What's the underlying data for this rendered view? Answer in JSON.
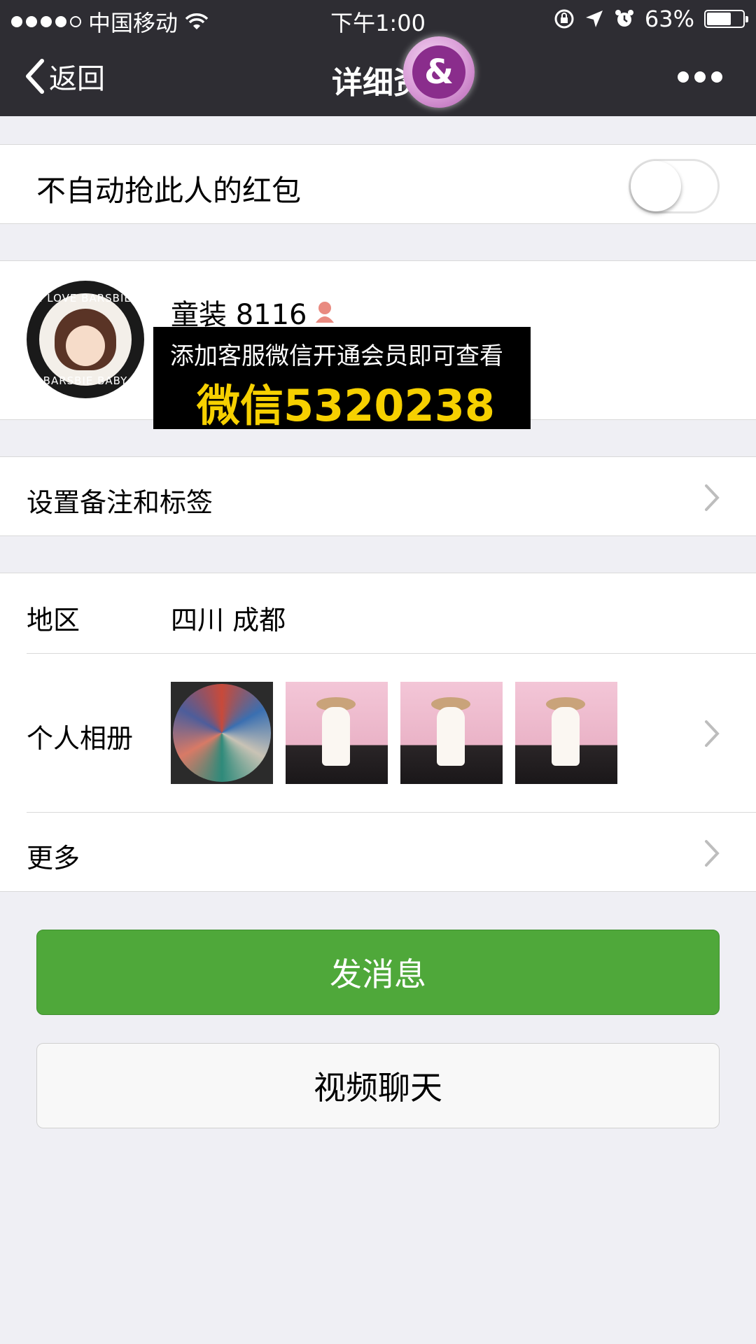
{
  "status_bar": {
    "carrier": "中国移动",
    "time": "下午1:00",
    "battery": "63%",
    "battery_level": 0.63
  },
  "nav": {
    "back_label": "返回",
    "title": "详细资",
    "watermark_badge": "&"
  },
  "red_packet": {
    "label": "不自动抢此人的红包",
    "enabled": false
  },
  "profile": {
    "nickname": "童装 8116",
    "avatar_text_top": "I LOVE BARSBIE",
    "avatar_text_bottom": "BARSBIE BABY",
    "gender_icon": "female-icon",
    "promo_line1": "添加客服微信开通会员即可查看",
    "promo_line2": "微信5320238"
  },
  "remark": {
    "label": "设置备注和标签"
  },
  "region": {
    "label": "地区",
    "value": "四川 成都"
  },
  "album": {
    "label": "个人相册",
    "photos": [
      "photo-thumbnail",
      "photo-thumbnail",
      "photo-thumbnail",
      "photo-thumbnail"
    ]
  },
  "more": {
    "label": "更多"
  },
  "actions": {
    "send_message": "发消息",
    "video_chat": "视频聊天"
  },
  "colors": {
    "nav_bg": "#2e2d33",
    "primary_green": "#4fa83a",
    "page_bg": "#efeff4",
    "promo_yellow": "#f6d000"
  }
}
